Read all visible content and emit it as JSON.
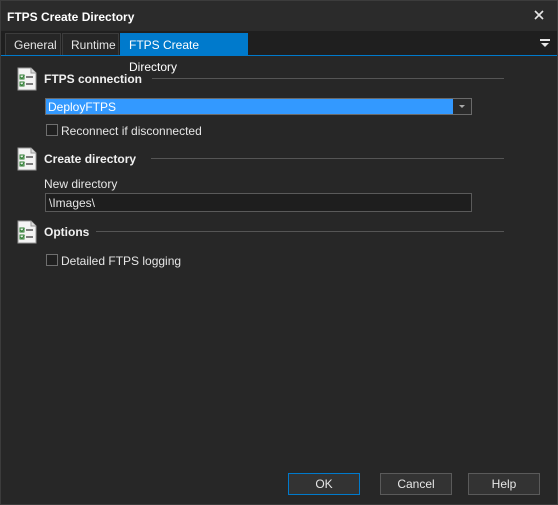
{
  "window": {
    "title": "FTPS Create Directory"
  },
  "tabs": [
    {
      "label": "General"
    },
    {
      "label": "Runtime"
    },
    {
      "label": "FTPS Create Directory"
    }
  ],
  "sections": {
    "connection": {
      "title": "FTPS connection",
      "combo_value": "DeployFTPS",
      "reconnect_label": "Reconnect if disconnected",
      "reconnect_checked": false
    },
    "create_directory": {
      "title": "Create directory",
      "new_directory_label": "New directory",
      "new_directory_value": "\\Images\\"
    },
    "options": {
      "title": "Options",
      "logging_label": "Detailed FTPS logging",
      "logging_checked": false
    }
  },
  "buttons": {
    "ok": "OK",
    "cancel": "Cancel",
    "help": "Help"
  },
  "colors": {
    "accent": "#007acc",
    "selection": "#3399ff",
    "background": "#272727"
  },
  "icons": {
    "close": "close-icon",
    "menu": "menu-icon",
    "section": "checklist-icon",
    "dropdown": "chevron-down-icon"
  }
}
